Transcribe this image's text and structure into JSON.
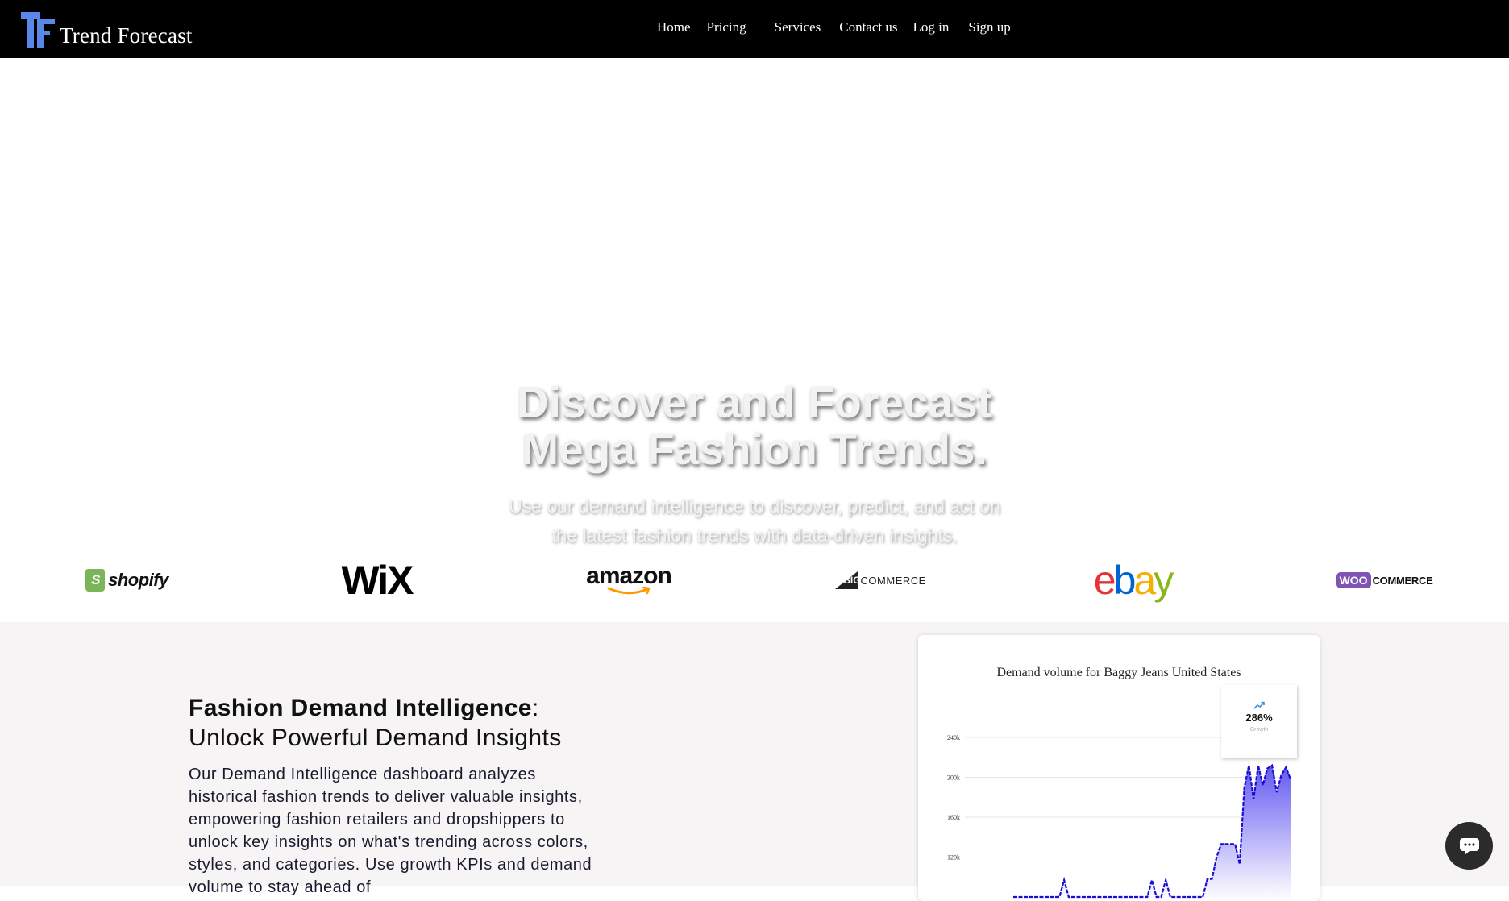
{
  "header": {
    "logo_text": "Trend Forecast",
    "logo_mark": "TF",
    "nav": [
      "Home",
      "Pricing",
      "Services",
      "Contact us",
      "Log in",
      "Sign up"
    ]
  },
  "hero": {
    "title_line1": "Discover and Forecast",
    "title_line2": "Mega Fashion Trends.",
    "subtitle_line1": "Use our demand intelligence to discover, predict, and act on",
    "subtitle_line2": "the latest fashion trends with data-driven insights."
  },
  "brands": {
    "shopify": "shopify",
    "wix": "WiX",
    "amazon": "amazon",
    "bigcommerce_big": "BIG",
    "bigcommerce_rest": "COMMERCE",
    "ebay": [
      "e",
      "b",
      "a",
      "y"
    ],
    "woo": "WOO",
    "woocommerce_rest": "COMMERCE"
  },
  "section": {
    "heading_bold": "Fashion Demand Intelligence",
    "heading_colon": ":",
    "heading_rest": "Unlock Powerful Demand Insights",
    "desc": "Our Demand Intelligence dashboard analyzes historical fashion trends to deliver valuable insights, empowering fashion retailers and dropshippers to unlock key insights on what's trending across colors, styles, and categories. Use growth KPIs and demand volume to stay ahead of"
  },
  "chart_card": {
    "title": "Demand volume for Baggy Jeans United States",
    "growth_value": "286%",
    "growth_label": "Growth"
  },
  "chart_data": {
    "type": "area",
    "title": "Demand volume for Baggy Jeans United States",
    "ylabel": "",
    "y_ticks": [
      "240k",
      "200k",
      "160k",
      "120k"
    ],
    "ylim": [
      80000,
      260000
    ],
    "series": [
      {
        "values": [
          80000,
          80000,
          80000,
          80000,
          80000,
          80000,
          80000,
          80000,
          80000,
          80000,
          80000,
          97000,
          80000,
          80000,
          80000,
          80000,
          80000,
          80000,
          80000,
          80000,
          80000,
          80000,
          80000,
          80000,
          80000,
          80000,
          80000,
          80000,
          80000,
          80000,
          97000,
          80000,
          80000,
          97000,
          80000,
          80000,
          80000,
          80000,
          80000,
          80000,
          80000,
          80000,
          98000,
          98000,
          120000,
          133000,
          133000,
          133000,
          133000,
          113000,
          190000,
          212000,
          178000,
          212000,
          192000,
          209000,
          212000,
          185000,
          202000,
          210000,
          198000
        ]
      }
    ],
    "colors": {
      "line": "#1a0fd1",
      "fill_top": "#5a4ff0",
      "fill_bottom": "#ffffff"
    },
    "grid": true
  },
  "colors": {
    "topbar": "#000000",
    "logo_accent": "#5b87e8",
    "lower_bg": "#f6f4f4",
    "ebay": [
      "#e53238",
      "#0064d2",
      "#f5af02",
      "#86b817"
    ],
    "woo": "#7f54b3"
  },
  "icons": {
    "growth": "trending-up-icon",
    "chat": "chat-bubble-icon"
  }
}
